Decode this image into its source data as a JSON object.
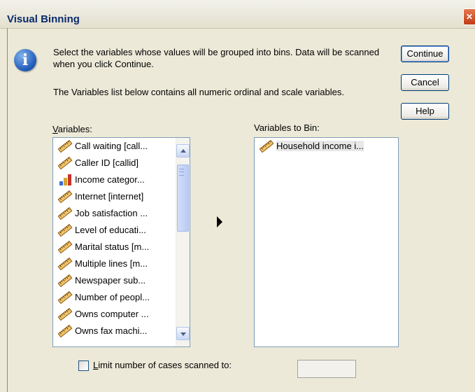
{
  "window": {
    "title": "Visual Binning",
    "close_glyph": "✕"
  },
  "info": {
    "icon_glyph": "i",
    "message_1": "Select the variables whose values will be grouped into bins. Data will be scanned when you click Continue.",
    "message_2": "The Variables list below contains all numeric ordinal and scale variables."
  },
  "buttons": {
    "continue": "Continue",
    "cancel": "Cancel",
    "help": "Help"
  },
  "variables_label": {
    "mnemonic": "V",
    "rest": "ariables:"
  },
  "variables_to_bin_label": "Variables to Bin:",
  "variables": [
    {
      "label": "Call waiting [call...",
      "icon": "scale-ruler-icon"
    },
    {
      "label": "Caller ID [callid]",
      "icon": "scale-ruler-icon"
    },
    {
      "label": "Income categor...",
      "icon": "ordinal-bars-icon"
    },
    {
      "label": "Internet [internet]",
      "icon": "scale-ruler-icon"
    },
    {
      "label": "Job satisfaction ...",
      "icon": "scale-ruler-icon"
    },
    {
      "label": "Level of educati...",
      "icon": "scale-ruler-icon"
    },
    {
      "label": "Marital status [m...",
      "icon": "scale-ruler-icon"
    },
    {
      "label": "Multiple lines [m...",
      "icon": "scale-ruler-icon"
    },
    {
      "label": "Newspaper sub...",
      "icon": "scale-ruler-icon"
    },
    {
      "label": "Number of peopl...",
      "icon": "scale-ruler-icon"
    },
    {
      "label": "Owns computer ...",
      "icon": "scale-ruler-icon"
    },
    {
      "label": "Owns fax machi...",
      "icon": "scale-ruler-icon"
    }
  ],
  "variables_to_bin": [
    {
      "label": "Household income i...",
      "icon": "scale-ruler-icon"
    }
  ],
  "limit": {
    "mnemonic": "L",
    "rest": "imit number of cases scanned to:",
    "checked": false,
    "value": ""
  }
}
